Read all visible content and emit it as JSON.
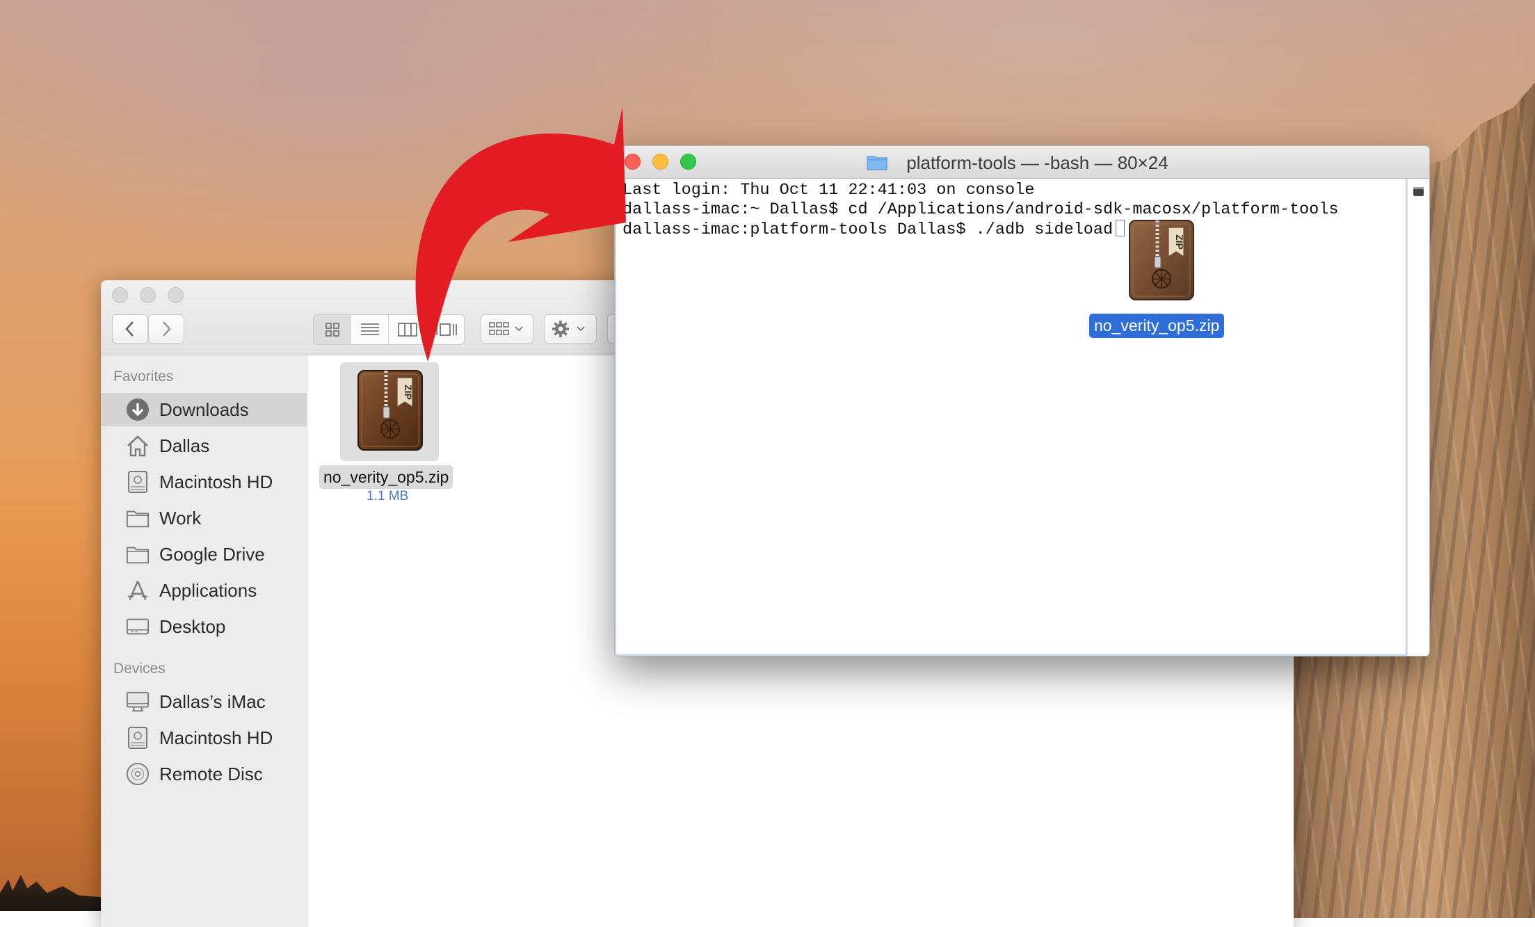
{
  "finder": {
    "favorites_heading": "Favorites",
    "devices_heading": "Devices",
    "favorites": [
      {
        "label": "Downloads",
        "icon": "downloads-icon",
        "selected": true
      },
      {
        "label": "Dallas",
        "icon": "home-icon",
        "selected": false
      },
      {
        "label": "Macintosh HD",
        "icon": "hard-drive-icon",
        "selected": false
      },
      {
        "label": "Work",
        "icon": "folder-icon",
        "selected": false
      },
      {
        "label": "Google Drive",
        "icon": "folder-icon",
        "selected": false
      },
      {
        "label": "Applications",
        "icon": "applications-icon",
        "selected": false
      },
      {
        "label": "Desktop",
        "icon": "desktop-folder-icon",
        "selected": false
      }
    ],
    "devices": [
      {
        "label": "Dallas’s iMac",
        "icon": "imac-icon"
      },
      {
        "label": "Macintosh HD",
        "icon": "hard-drive-icon"
      },
      {
        "label": "Remote Disc",
        "icon": "disc-icon"
      }
    ],
    "file": {
      "name": "no_verity_op5.zip",
      "size": "1.1 MB",
      "icon": "zip-archive-icon"
    }
  },
  "terminal": {
    "title": "platform-tools — -bash — 80×24",
    "lines": [
      "Last login: Thu Oct 11 22:41:03 on console",
      "dallass-imac:~ Dallas$ cd /Applications/android-sdk-macosx/platform-tools",
      "dallass-imac:platform-tools Dallas$ ./adb sideload"
    ]
  },
  "drag": {
    "file_name": "no_verity_op5.zip",
    "icon": "zip-archive-icon"
  },
  "annotation": {
    "arrow_color": "#e31b23"
  }
}
